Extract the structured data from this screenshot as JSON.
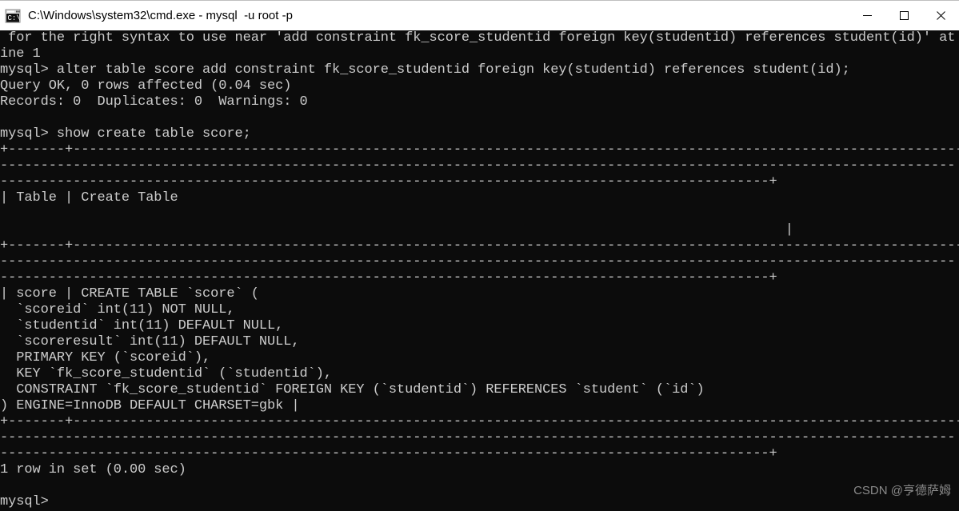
{
  "window": {
    "title": "C:\\Windows\\system32\\cmd.exe - mysql  -u root -p",
    "icon": "cmd-icon",
    "titlebar_bg": "#ffffff",
    "titlebar_text_color": "#000000",
    "controls": {
      "minimize_label": "—",
      "maximize_label": "□",
      "close_label": "✕"
    }
  },
  "terminal": {
    "background": "#0c0c0c",
    "foreground": "#cccccc",
    "prompt": "mysql>",
    "columns": 117,
    "lines": [
      " for the right syntax to use near 'add constraint fk_score_studentid foreign key(studentid) references student(id)' at l",
      "ine 1",
      "mysql> alter table score add constraint fk_score_studentid foreign key(studentid) references student(id);",
      "Query OK, 0 rows affected (0.04 sec)",
      "Records: 0  Duplicates: 0  Warnings: 0",
      "",
      "mysql> show create table score;",
      "+-------+---------------------------------------------------------------------------------------------------------------",
      "----------------------------------------------------------------------------------------------------------------------",
      "-----------------------------------------------------------------------------------------------+",
      "| Table | Create Table",
      "",
      "                                                                                                 |",
      "+-------+---------------------------------------------------------------------------------------------------------------",
      "----------------------------------------------------------------------------------------------------------------------",
      "-----------------------------------------------------------------------------------------------+",
      "| score | CREATE TABLE `score` (",
      "  `scoreid` int(11) NOT NULL,",
      "  `studentid` int(11) DEFAULT NULL,",
      "  `scoreresult` int(11) DEFAULT NULL,",
      "  PRIMARY KEY (`scoreid`),",
      "  KEY `fk_score_studentid` (`studentid`),",
      "  CONSTRAINT `fk_score_studentid` FOREIGN KEY (`studentid`) REFERENCES `student` (`id`)",
      ") ENGINE=InnoDB DEFAULT CHARSET=gbk |",
      "+-------+---------------------------------------------------------------------------------------------------------------",
      "----------------------------------------------------------------------------------------------------------------------",
      "-----------------------------------------------------------------------------------------------+",
      "1 row in set (0.00 sec)",
      "",
      "mysql>"
    ]
  },
  "watermark": {
    "text": "CSDN @亨德萨姆",
    "color": "#8a8a8a"
  }
}
